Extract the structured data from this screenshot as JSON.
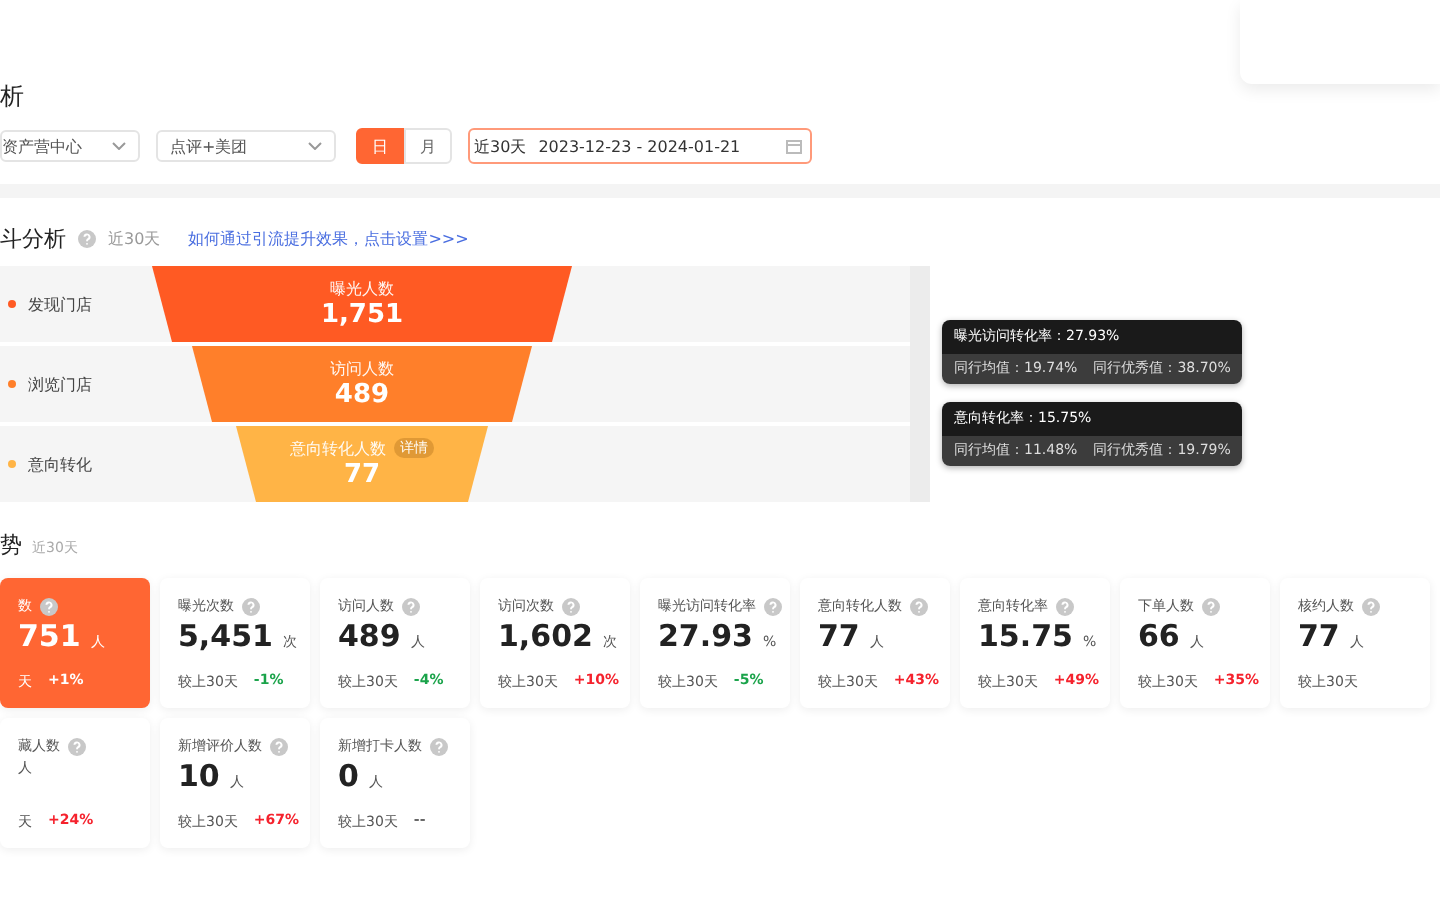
{
  "page_title": "析",
  "filters": {
    "store_select": "资产营中心",
    "platform_select": "点评+美团",
    "period_toggle": [
      {
        "label": "日",
        "selected": true
      },
      {
        "label": "月",
        "selected": false
      }
    ],
    "date_range": {
      "preset": "近30天",
      "value": "2023-12-23 - 2024-01-21"
    }
  },
  "funnel": {
    "title": "斗分析",
    "period": "近30天",
    "link": "如何通过引流提升效果，点击设置>>>",
    "stages": [
      {
        "row_label": "发现门店",
        "label": "曝光人数",
        "value": "1,751",
        "color": "#ff5a23"
      },
      {
        "row_label": "浏览门店",
        "label": "访问人数",
        "value": "489",
        "color": "#ff7f2a"
      },
      {
        "row_label": "意向转化",
        "label": "意向转化人数",
        "value": "77",
        "badge": "详情",
        "color": "#ffb446"
      }
    ],
    "conversions": [
      {
        "title": "曝光访问转化率：27.93%",
        "average": "同行均值：19.74%",
        "excellent": "同行优秀值：38.70%"
      },
      {
        "title": "意向转化率：15.75%",
        "average": "同行均值：11.48%",
        "excellent": "同行优秀值：19.79%"
      }
    ]
  },
  "trend": {
    "title": "势",
    "period": "近30天",
    "cards": [
      [
        {
          "label": "数",
          "value": "751",
          "unit": "人",
          "compare": "天",
          "change": "+1%",
          "kind": "increase",
          "selected": true
        },
        {
          "label": "曝光次数",
          "value": "5,451",
          "unit": "次",
          "compare": "较上30天",
          "change": "-1%",
          "kind": "decrease",
          "selected": false
        },
        {
          "label": "访问人数",
          "value": "489",
          "unit": "人",
          "compare": "较上30天",
          "change": "-4%",
          "kind": "decrease",
          "selected": false
        },
        {
          "label": "访问次数",
          "value": "1,602",
          "unit": "次",
          "compare": "较上30天",
          "change": "+10%",
          "kind": "increase",
          "selected": false
        },
        {
          "label": "曝光访问转化率",
          "value": "27.93",
          "unit": "%",
          "compare": "较上30天",
          "change": "-5%",
          "kind": "decrease",
          "selected": false
        },
        {
          "label": "意向转化人数",
          "value": "77",
          "unit": "人",
          "compare": "较上30天",
          "change": "+43%",
          "kind": "increase",
          "selected": false
        },
        {
          "label": "意向转化率",
          "value": "15.75",
          "unit": "%",
          "compare": "较上30天",
          "change": "+49%",
          "kind": "increase",
          "selected": false
        },
        {
          "label": "下单人数",
          "value": "66",
          "unit": "人",
          "compare": "较上30天",
          "change": "+35%",
          "kind": "increase",
          "selected": false
        },
        {
          "label": "核约人数",
          "value": "77",
          "unit": "人",
          "compare": "较上30天",
          "selected": false
        }
      ],
      [
        {
          "label": "藏人数",
          "unit": "人",
          "compare": "天",
          "change": "+24%",
          "kind": "increase",
          "selected": false
        },
        {
          "label": "新增评价人数",
          "value": "10",
          "unit": "人",
          "compare": "较上30天",
          "change": "+67%",
          "kind": "increase",
          "selected": false
        },
        {
          "label": "新增打卡人数",
          "value": "0",
          "unit": "人",
          "compare": "较上30天",
          "change": "--",
          "kind": "none",
          "selected": false
        }
      ]
    ]
  }
}
